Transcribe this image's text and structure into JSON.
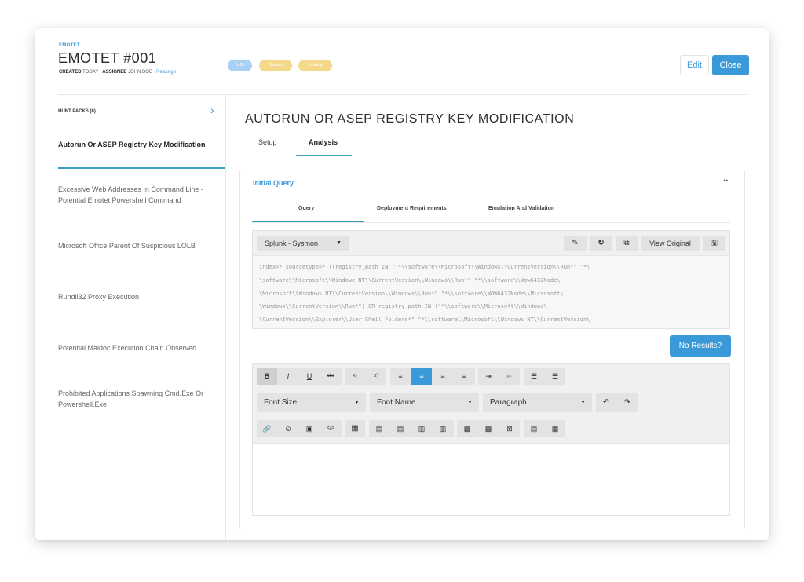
{
  "header": {
    "crumb": "EMOTET",
    "title": "EMOTET #001",
    "created_label": "CREATED",
    "created_value": "TODAY",
    "assignee_label": "ASSIGNEE",
    "assignee_value": "JOHN DOE",
    "reassign_label": "Reassign",
    "status_pills": [
      {
        "label": "To Do",
        "color": "#a9d0f5"
      },
      {
        "label": "Medium",
        "color": "#f5d98a"
      },
      {
        "label": "Pending",
        "color": "#f5d98a"
      }
    ],
    "edit_label": "Edit",
    "close_label": "Close"
  },
  "sidebar": {
    "heading": "HUNT PACKS (6)",
    "items": [
      {
        "label": "Autorun Or ASEP Registry Key Modification"
      },
      {
        "label": "Excessive Web Addresses In Command Line - Potential Emotet Powershell Command"
      },
      {
        "label": "Microsoft Office Parent Of Suspicious LOLB"
      },
      {
        "label": "Rundll32 Proxy Execution"
      },
      {
        "label": "Potential Maldoc Execution Chain Observed"
      },
      {
        "label": "Prohibited Applications Spawning Cmd.Exe Or Powershell.Exe"
      }
    ]
  },
  "main": {
    "title": "AUTORUN OR ASEP REGISTRY KEY MODIFICATION",
    "tabs": [
      "Setup",
      "Analysis"
    ],
    "active_tab": "Analysis",
    "section_title": "Initial Query",
    "subtabs": [
      "Query",
      "Deployment Requirements",
      "Emulation And Validation"
    ],
    "active_subtab": "Query",
    "query": {
      "platform": "Splunk - Sysmon",
      "view_original_label": "View Original",
      "lines": [
        "index=* sourcetype=* ((registry_path IN (\"*\\\\software\\\\Microsoft\\\\Windows\\\\CurrentVersion\\\\Run*\" \"*\\",
        "\\software\\\\Microsoft\\\\Windowe NT\\\\CurrentVersion\\\\Windows\\\\Run*\" \"*\\\\software\\\\Wow6432Node\\",
        "\\Microsoft\\\\Windows NT\\\\CurrentVersion\\\\Windows\\\\Run*\" \"*\\\\software\\\\WOW6432Node\\\\Microsoft\\",
        "\\Windows\\\\CurrentVersion\\\\Run*\") OR registry_path IN (\"*\\\\software\\\\Microsoft\\\\Windows\\",
        "\\CurrentVersion\\\\Explorer\\\\User Shell Folders*\" \"*\\\\software\\\\Microsoft\\\\Windows NT\\\\CurrentVersion\\"
      ]
    },
    "no_results_label": "No Results?",
    "editor": {
      "font_size_label": "Font Size",
      "font_name_label": "Font Name",
      "paragraph_label": "Paragraph"
    }
  },
  "colors": {
    "accent": "#3a9ad9",
    "underline": "#3aa0b8"
  }
}
